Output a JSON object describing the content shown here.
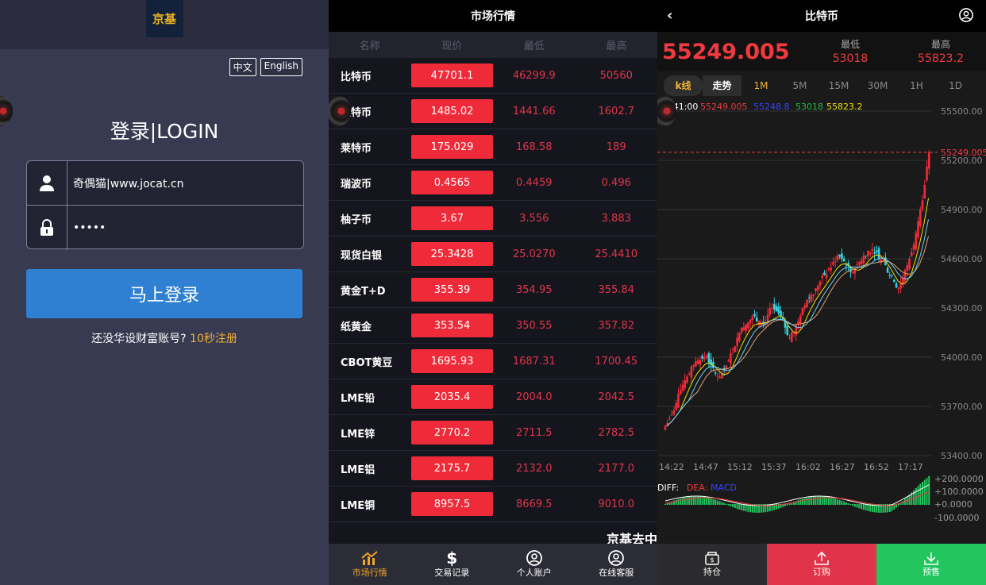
{
  "login": {
    "logo": "京基",
    "lang_zh": "中文",
    "lang_en": "English",
    "title": "登录|LOGIN",
    "username": "奇偶猫|www.jocat.cn",
    "password": "•••••",
    "submit": "马上登录",
    "register_prompt": "还没华设财富账号?",
    "register_link": "10秒注册"
  },
  "market": {
    "title": "市场行情",
    "columns": [
      "名称",
      "现价",
      "最低",
      "最高"
    ],
    "rows": [
      {
        "name": "比特币",
        "price": "47701.1",
        "low": "46299.9",
        "high": "50560"
      },
      {
        "name": "以特币",
        "price": "1485.02",
        "low": "1441.66",
        "high": "1602.7"
      },
      {
        "name": "莱特币",
        "price": "175.029",
        "low": "168.58",
        "high": "189"
      },
      {
        "name": "瑞波币",
        "price": "0.4565",
        "low": "0.4459",
        "high": "0.496"
      },
      {
        "name": "柚子币",
        "price": "3.67",
        "low": "3.556",
        "high": "3.883"
      },
      {
        "name": "现货白银",
        "price": "25.3428",
        "low": "25.0270",
        "high": "25.4410"
      },
      {
        "name": "黄金T+D",
        "price": "355.39",
        "low": "354.95",
        "high": "355.84"
      },
      {
        "name": "纸黄金",
        "price": "353.54",
        "low": "350.55",
        "high": "357.82"
      },
      {
        "name": "CBOT黄豆",
        "price": "1695.93",
        "low": "1687.31",
        "high": "1700.45"
      },
      {
        "name": "LME铅",
        "price": "2035.4",
        "low": "2004.0",
        "high": "2042.5"
      },
      {
        "name": "LME锌",
        "price": "2770.2",
        "low": "2711.5",
        "high": "2782.5"
      },
      {
        "name": "LME铝",
        "price": "2175.7",
        "low": "2132.0",
        "high": "2177.0"
      },
      {
        "name": "LME铜",
        "price": "8957.5",
        "low": "8669.5",
        "high": "9010.0"
      }
    ],
    "marquee": "京基去中",
    "tabs": [
      "市场行情",
      "交易记录",
      "个人账户",
      "在线客服"
    ]
  },
  "coin": {
    "title": "比特币",
    "price": "55249.005",
    "low_label": "最低",
    "low": "53018",
    "high_label": "最高",
    "high": "55823.2",
    "tabs": [
      "k线",
      "走势",
      "1M",
      "5M",
      "15M",
      "30M",
      "1H",
      "1D"
    ],
    "legend": {
      "time": "16:41:00",
      "v1": "55249.005",
      "v2": "55248.8",
      "v3": "53018",
      "v4": "55823.2"
    },
    "macd_labels": [
      "DIFF:",
      "DEA:",
      "MACD"
    ],
    "bottom": [
      "持仓",
      "订购",
      "预售"
    ]
  },
  "chart_data": {
    "type": "candlestick",
    "y_ticks": [
      "55500.00",
      "55200.00",
      "54900.00",
      "54600.00",
      "54300.00",
      "54000.00",
      "53700.00",
      "53400.00"
    ],
    "x_ticks": [
      "14:22",
      "14:47",
      "15:12",
      "15:37",
      "16:02",
      "16:27",
      "16:52",
      "17:17"
    ],
    "last_price_label": "55249.005",
    "macd_ticks": [
      "+200.0000",
      "+100.0000",
      "+0.0000",
      "-100.0000"
    ],
    "ylim": [
      53400,
      55500
    ],
    "close_series": [
      53600,
      53650,
      53720,
      53800,
      53860,
      53900,
      53950,
      53980,
      53990,
      54010,
      53950,
      53900,
      53880,
      53920,
      53980,
      54050,
      54120,
      54180,
      54200,
      54230,
      54250,
      54220,
      54200,
      54260,
      54300,
      54280,
      54250,
      54180,
      54120,
      54150,
      54220,
      54300,
      54350,
      54380,
      54420,
      54460,
      54500,
      54540,
      54580,
      54620,
      54600,
      54560,
      54520,
      54540,
      54580,
      54620,
      54650,
      54660,
      54640,
      54600,
      54560,
      54500,
      54460,
      54420,
      54480,
      54560,
      54640,
      54760,
      54900,
      55050,
      55249
    ]
  },
  "colors": {
    "up": "#ef2b3a",
    "down": "#35d3e0",
    "brand_blue": "#2f7fd3",
    "gold": "#f0b23a",
    "buy": "#e0344a",
    "sell": "#22c55e"
  }
}
